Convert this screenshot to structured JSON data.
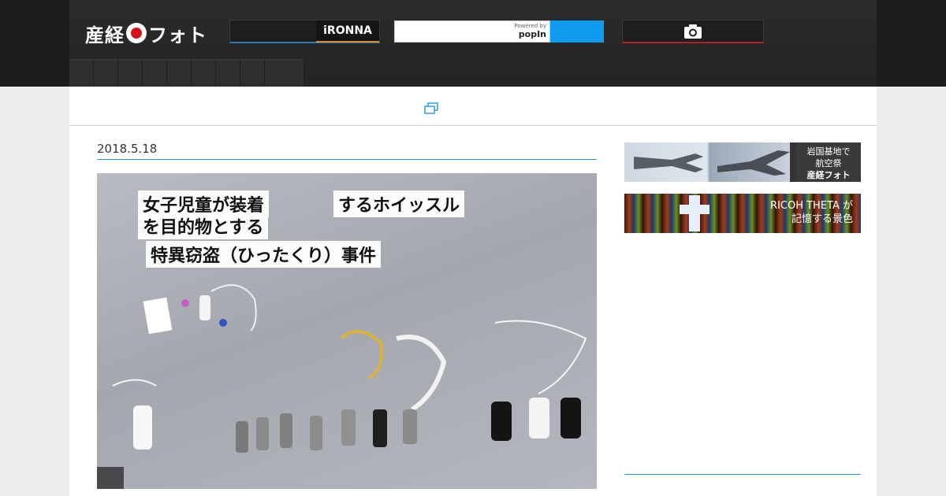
{
  "header": {
    "logo_text": "産経",
    "logo_suffix": "フォト",
    "ironna_label": "iRONNA",
    "search": {
      "placeholder": "",
      "powered_by": "Powered by",
      "provider": "popIn"
    },
    "search_button_icon": "search-icon",
    "camera_icon": "camera-icon",
    "nav_tab_count": 9
  },
  "toolbar": {
    "gallery_icon": "gallery-icon"
  },
  "article": {
    "date": "2018.5.18",
    "photo": {
      "sign_line1a": "女子児童が装着",
      "sign_line1b": "するホイッスル",
      "sign_line2": "を目的物とする",
      "sign_line3": "特異窃盗（ひったくり）事件"
    }
  },
  "sidebar": {
    "banner1": {
      "line1": "岩国基地で",
      "line2": "航空祭",
      "brand": "産経フォト"
    },
    "banner2": {
      "line1": "RICOH THETA が",
      "line2": "記憶する景色"
    }
  },
  "colors": {
    "accent_blue": "#2a9fd6",
    "search_blue": "#0f9bef",
    "header_dark": "#2b2b2b",
    "brand_red": "#d4141b"
  }
}
